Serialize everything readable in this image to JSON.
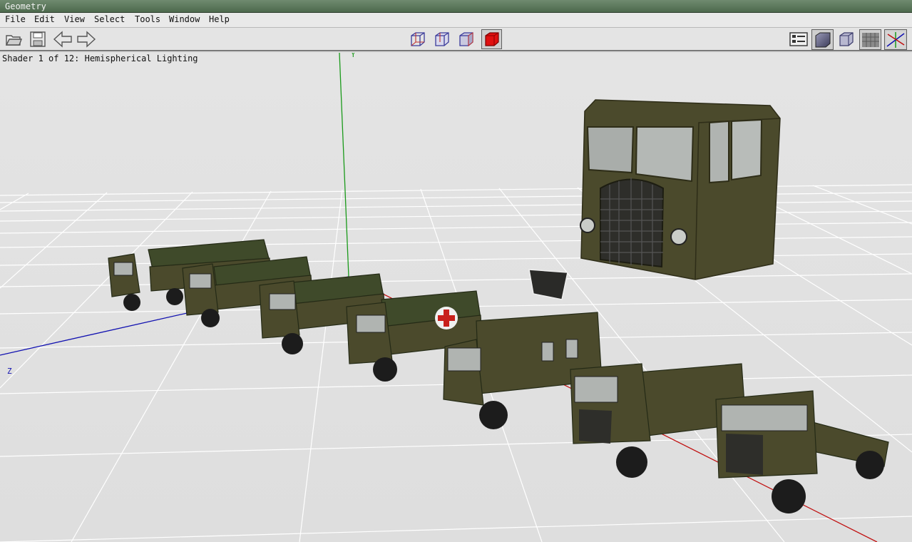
{
  "window": {
    "title": "Geometry"
  },
  "menu": [
    "File",
    "Edit",
    "View",
    "Select",
    "Tools",
    "Window",
    "Help"
  ],
  "viewport": {
    "status": "Shader 1 of 12: Hemispherical Lighting",
    "axis_y": "Y",
    "axis_z": "Z"
  },
  "icons": {
    "left": [
      "open-folder-icon",
      "save-icon",
      "back-arrow-icon",
      "forward-arrow-icon"
    ],
    "center": [
      "wireframe-cube-icon",
      "hidden-line-cube-icon",
      "flat-cube-icon",
      "solid-red-cube-icon"
    ],
    "right": [
      "panel-list-icon",
      "smooth-shaded-cube-icon",
      "cube-outline-icon",
      "grid-icon",
      "axes-icon"
    ]
  },
  "colors": {
    "title_bar": "#5c785c",
    "truck_olive": "#4b4a2c",
    "red_cross": "#c8201c",
    "axis_x": "#c01010",
    "axis_y": "#1a9a1a",
    "axis_z": "#1010b0",
    "selected_shader": "#e01010"
  }
}
